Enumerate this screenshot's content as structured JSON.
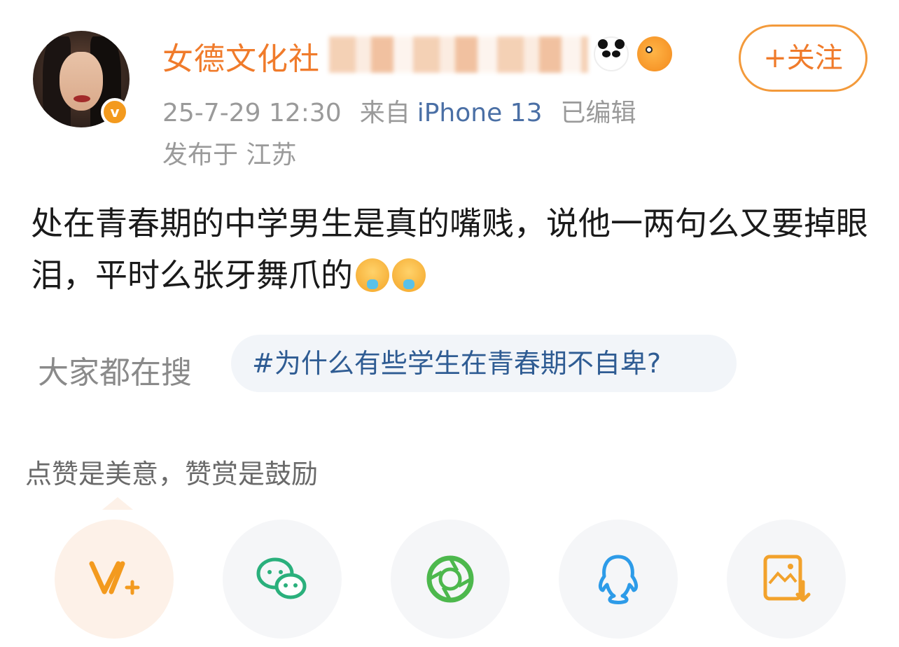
{
  "post": {
    "username": "女德文化社",
    "follow_label": "+关注",
    "date": "25-7-29 12:30",
    "source_prefix": "来自",
    "device": "iPhone 13",
    "edited": "已编辑",
    "location": "发布于 江苏",
    "content": "处在青春期的中学男生是真的嘴贱，说他一两句么又要掉眼泪，平时么张牙舞爪的",
    "content_emoji": "crying-face-icon"
  },
  "search": {
    "label": "大家都在搜",
    "topic": "#为什么有些学生在青春期不自卑?"
  },
  "reward": {
    "tip": "点赞是美意，赞赏是鼓励"
  },
  "share": {
    "items": [
      {
        "icon": "weibo-v-plus-icon",
        "color": "#f39a1e"
      },
      {
        "icon": "wechat-icon",
        "color": "#2ab07c"
      },
      {
        "icon": "moments-icon",
        "color": "#4db84d"
      },
      {
        "icon": "qq-icon",
        "color": "#2d9be8"
      },
      {
        "icon": "save-image-icon",
        "color": "#f2a22c"
      }
    ]
  },
  "colors": {
    "accent": "#f07b2b",
    "link": "#4a6fa5",
    "topic": "#2f5c93"
  }
}
